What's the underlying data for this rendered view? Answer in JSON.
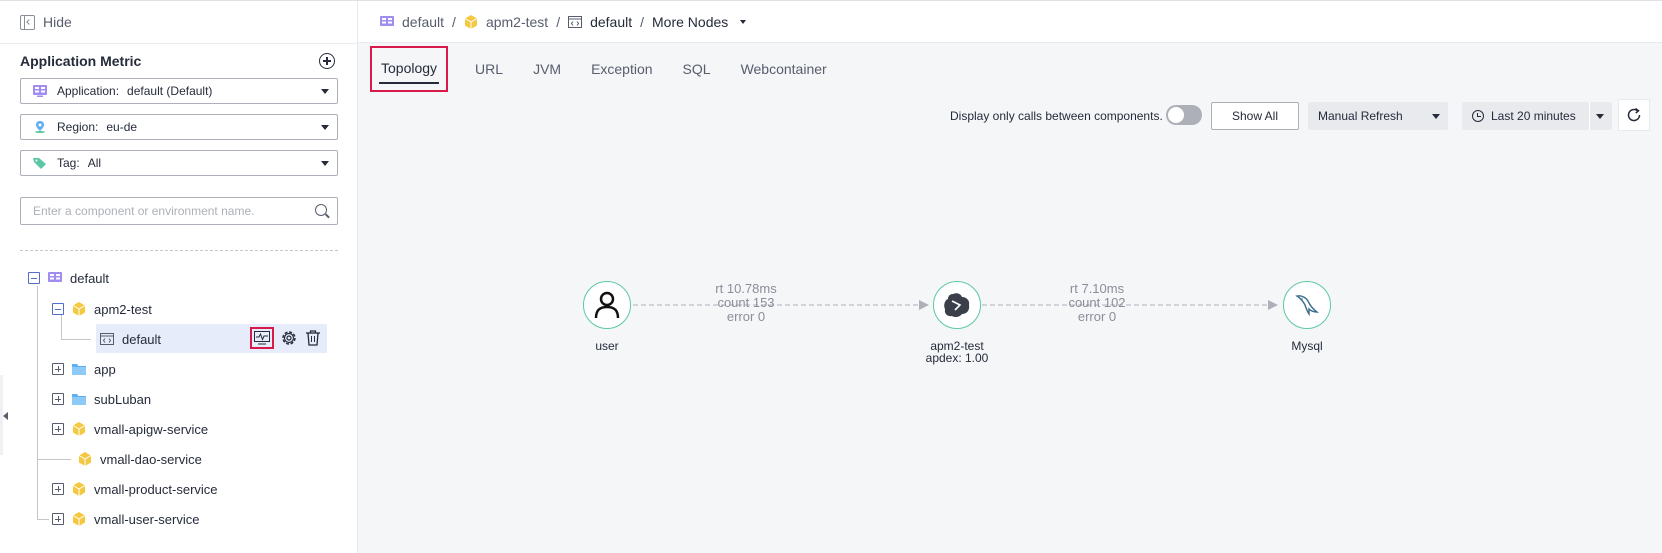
{
  "sidebar": {
    "hide_label": "Hide",
    "section_title": "Application Metric",
    "filters": [
      {
        "label": "Application:",
        "value": "default (Default)"
      },
      {
        "label": "Region:",
        "value": "eu-de"
      },
      {
        "label": "Tag:",
        "value": "All"
      }
    ],
    "search_placeholder": "Enter a component or environment name.",
    "tree": {
      "root": "default",
      "component": "apm2-test",
      "env": "default",
      "folders": [
        "app",
        "subLuban"
      ],
      "services": [
        "vmall-apigw-service",
        "vmall-dao-service",
        "vmall-product-service",
        "vmall-user-service"
      ]
    }
  },
  "breadcrumb": {
    "items": [
      "default",
      "apm2-test",
      "default"
    ],
    "more": "More Nodes",
    "separator": "/"
  },
  "tabs": [
    "Topology",
    "URL",
    "JVM",
    "Exception",
    "SQL",
    "Webcontainer"
  ],
  "active_tab": "Topology",
  "toolbar": {
    "display_label": "Display only calls between components.",
    "toggle_on": false,
    "show_all": "Show All",
    "refresh_mode": "Manual Refresh",
    "time_range": "Last 20 minutes"
  },
  "topology": {
    "nodes": [
      {
        "name": "user",
        "sub": ""
      },
      {
        "name": "apm2-test",
        "sub": "apdex: 1.00"
      },
      {
        "name": "Mysql",
        "sub": ""
      }
    ],
    "edges": [
      {
        "rt": "rt 10.78ms",
        "count": "count 153",
        "error": "error 0"
      },
      {
        "rt": "rt 7.10ms",
        "count": "count 102",
        "error": "error 0"
      }
    ]
  },
  "colors": {
    "accent": "#d8194a",
    "node_border": "#5cc7a5",
    "edge": "#adb0b8"
  }
}
